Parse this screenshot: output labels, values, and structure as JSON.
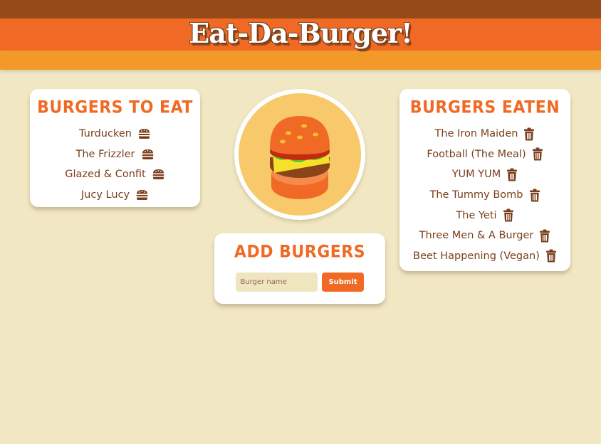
{
  "app": {
    "title": "Eat-Da-Burger!"
  },
  "colors": {
    "background": "#f1e8c3",
    "header_dark": "#964a17",
    "header_mid": "#f06a25",
    "header_light": "#f2992a",
    "accent": "#f06a25",
    "text": "#7a3e1b"
  },
  "to_eat": {
    "title": "Burgers To Eat",
    "action_icon": "burger-icon",
    "items": [
      {
        "label": "Turducken"
      },
      {
        "label": "The Frizzler"
      },
      {
        "label": "Glazed & Confit"
      },
      {
        "label": "Jucy Lucy"
      }
    ]
  },
  "eaten": {
    "title": "Burgers Eaten",
    "action_icon": "trash-icon",
    "items": [
      {
        "label": "The Iron Maiden"
      },
      {
        "label": "Football (The Meal)"
      },
      {
        "label": "YUM YUM"
      },
      {
        "label": "The Tummy Bomb"
      },
      {
        "label": "The Yeti"
      },
      {
        "label": "Three Men & A Burger"
      },
      {
        "label": "Beet Happening (Vegan)"
      }
    ]
  },
  "add": {
    "title": "Add Burgers",
    "input_placeholder": "Burger name",
    "input_value": "",
    "submit_label": "Submit"
  },
  "hero": {
    "icon": "burger-illustration-icon"
  }
}
